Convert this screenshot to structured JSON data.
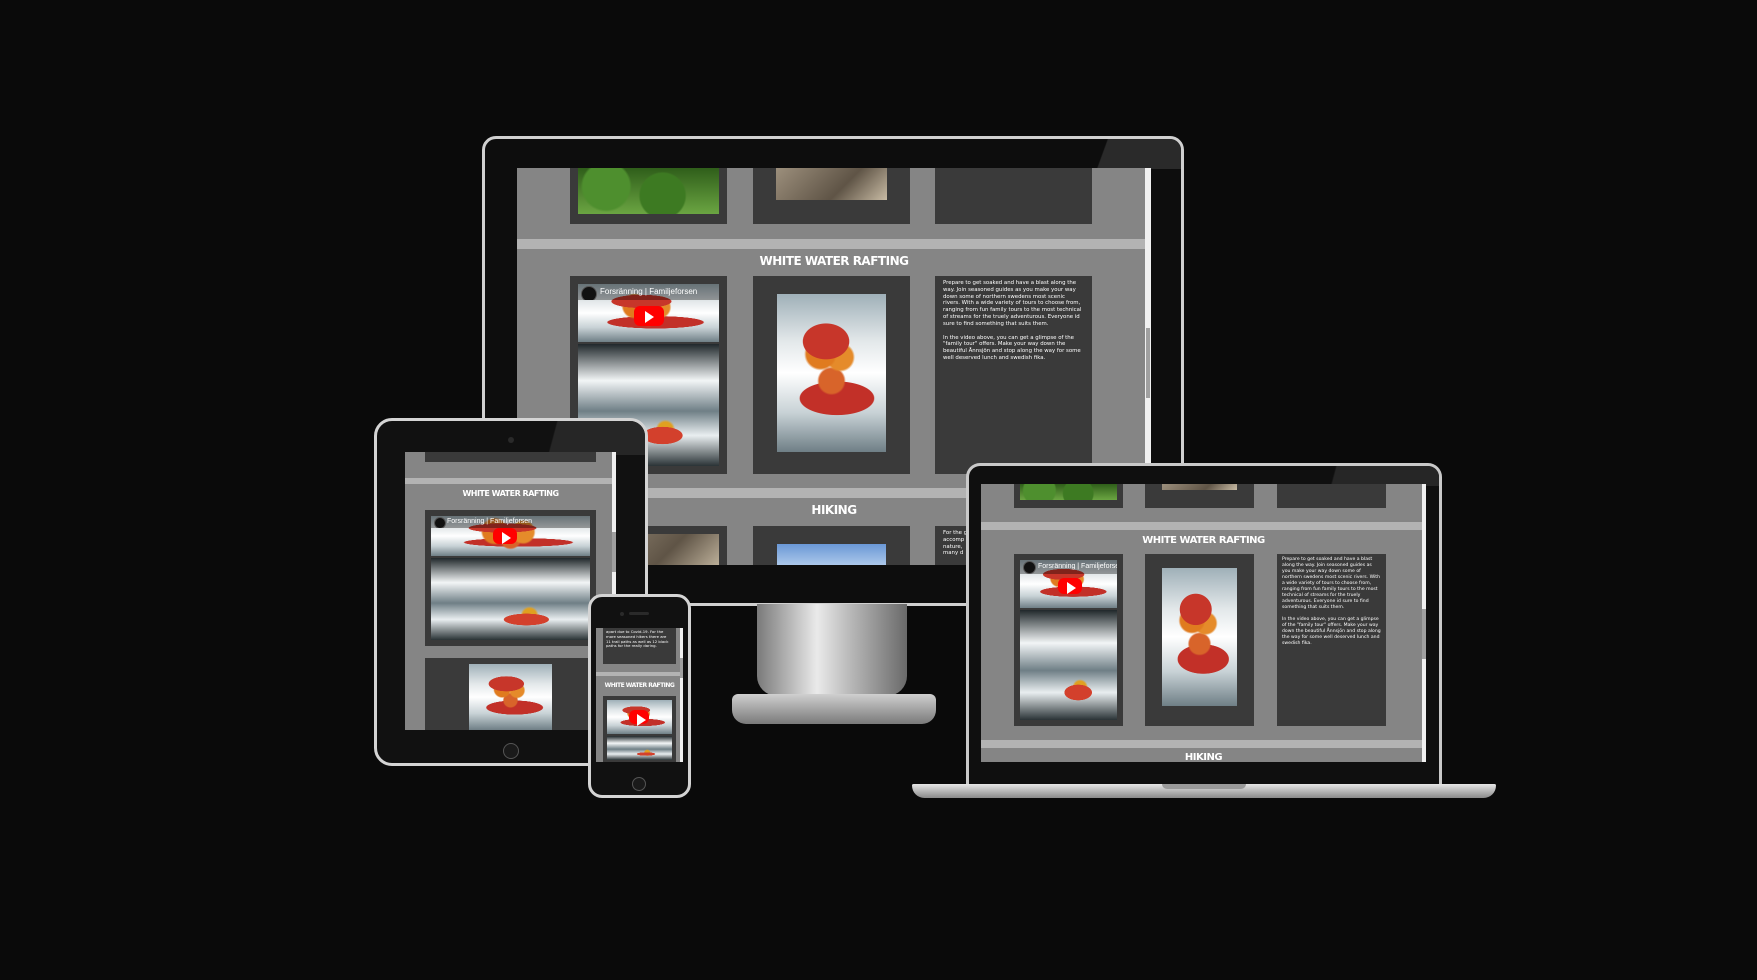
{
  "site": {
    "section_rafting_title": "WHITE WATER RAFTING",
    "section_hiking_title": "HIKING",
    "rafting_text_1": "Prepare to get soaked and have a blast along the way. Join seasoned guides as you make your way down some of northern swedens most scenic rivers. With a wide variety of tours to choose from, ranging from fun family tours to the most technical of streams for the truely adventurous. Everyone id sure to find something that suits them.",
    "rafting_text_2": "In the video above, you can get a glimpse of the \"family tour\" offers. Make your way down the beautiful Ånnsjön and stop along the way for some well deserved lunch and swedish fika.",
    "video_title": "Forsränning | Familjeforsen",
    "hiking_text_prefix": "For the g",
    "hiking_text_line2": "accomp",
    "hiking_text_line3": "nature,",
    "hiking_text_line4": "many d",
    "phone_text": "apart due to Covid-19. For the more seasoned hikers there are 11 trail paths as well as 12 black paths for the really daring."
  },
  "colors": {
    "page_background": "#0a0a0a",
    "site_background": "#858585",
    "card_background": "#3a3a3a",
    "divider_band": "#b3b3b3",
    "youtube_red": "#ff0000"
  }
}
